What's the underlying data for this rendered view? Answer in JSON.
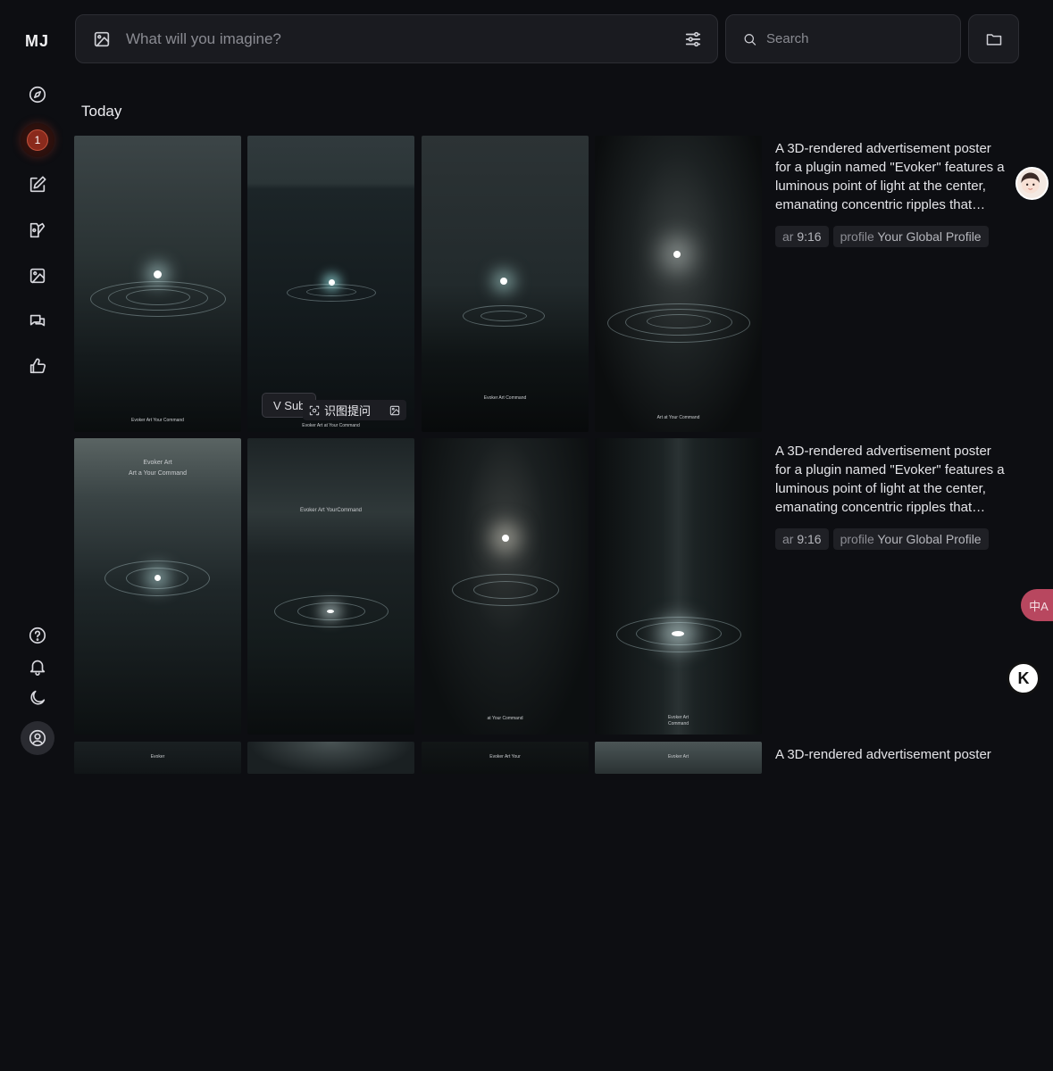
{
  "app": {
    "logo": "MJ"
  },
  "sidebar": {
    "badge_count": "1",
    "items": [
      {
        "name": "explore",
        "icon": "compass-icon"
      },
      {
        "name": "notifications",
        "icon": "badge"
      },
      {
        "name": "create",
        "icon": "edit-icon"
      },
      {
        "name": "edit",
        "icon": "edit-image-icon"
      },
      {
        "name": "organize",
        "icon": "image-icon"
      },
      {
        "name": "chat",
        "icon": "chat-icon"
      },
      {
        "name": "rank",
        "icon": "thumbs-up-icon"
      }
    ],
    "bottom": [
      "help-icon",
      "bell-icon",
      "moon-icon",
      "profile-icon"
    ]
  },
  "prompt": {
    "placeholder": "What will you imagine?"
  },
  "search": {
    "placeholder": "Search"
  },
  "section": {
    "title": "Today"
  },
  "jobs": [
    {
      "description": "A 3D-rendered advertisement poster for a plugin named \"Evoker\" features a luminous point of light at the center, emanating concentric ripples that…",
      "tags": [
        {
          "key": "ar",
          "value": "9:16"
        },
        {
          "key": "profile",
          "value": "Your Global Profile"
        }
      ],
      "captions": [
        "Evoker Art Your Command",
        "Evoker Art at Your Command",
        "Evoker Art Command",
        "Art at Your Command"
      ]
    },
    {
      "description": "A 3D-rendered advertisement poster for a plugin named \"Evoker\" features a luminous point of light at the center, emanating concentric ripples that…",
      "tags": [
        {
          "key": "ar",
          "value": "9:16"
        },
        {
          "key": "profile",
          "value": "Your Global Profile"
        }
      ],
      "captions": [
        "Evoker Art",
        "Evoker Art YourCommand",
        "at Your Command",
        "Evoker Art"
      ],
      "captions_sub": [
        "Art a Your Command",
        "",
        "",
        "Command"
      ]
    },
    {
      "description": "A 3D-rendered advertisement poster",
      "captions": [
        "Evoker",
        "",
        "Evoker Art Your",
        "Evoker Art"
      ]
    }
  ],
  "overlay": {
    "vsub_label": "V Sub",
    "ocr_label": "识图提问"
  },
  "translate_label": "中A",
  "k_label": "K",
  "colors": {
    "accent": "#8a2a1c",
    "background": "#0d0e12",
    "panel": "#1a1b20"
  }
}
